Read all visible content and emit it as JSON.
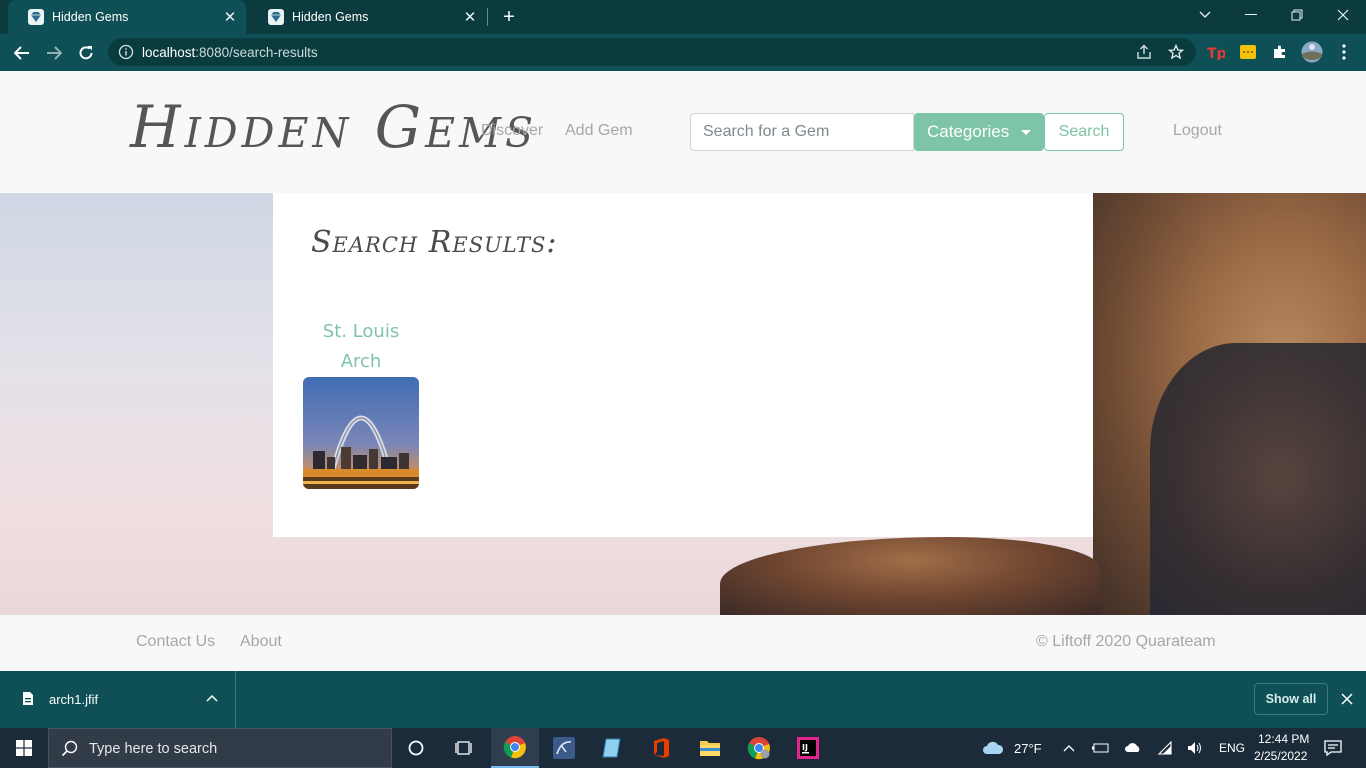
{
  "browser": {
    "tabs": [
      {
        "title": "Hidden Gems",
        "active": true
      },
      {
        "title": "Hidden Gems",
        "active": false
      }
    ],
    "address": {
      "host": "localhost",
      "path": ":8080/search-results"
    }
  },
  "header": {
    "brand": "Hidden Gems",
    "nav": [
      {
        "label": "Discover"
      },
      {
        "label": "Add Gem"
      }
    ],
    "search_placeholder": "Search for a Gem",
    "categories_label": "Categories",
    "search_button": "Search",
    "logout": "Logout"
  },
  "results": {
    "title": "Search Results:",
    "gems": [
      {
        "name_line1": "St. Louis",
        "name_line2": "Arch"
      }
    ]
  },
  "footer": {
    "links": [
      {
        "label": "Contact Us"
      },
      {
        "label": "About"
      }
    ],
    "copyright": "© Liftoff 2020 Quarateam"
  },
  "downloads": {
    "file": "arch1.jfif",
    "show_all": "Show all"
  },
  "taskbar": {
    "search_placeholder": "Type here to search",
    "weather": "27°F",
    "language": "ENG",
    "time": "12:44 PM",
    "date": "2/25/2022"
  },
  "colors": {
    "accent": "#7ec4a6",
    "chrome": "#0e5055",
    "tabbar": "#0b3b3f"
  }
}
